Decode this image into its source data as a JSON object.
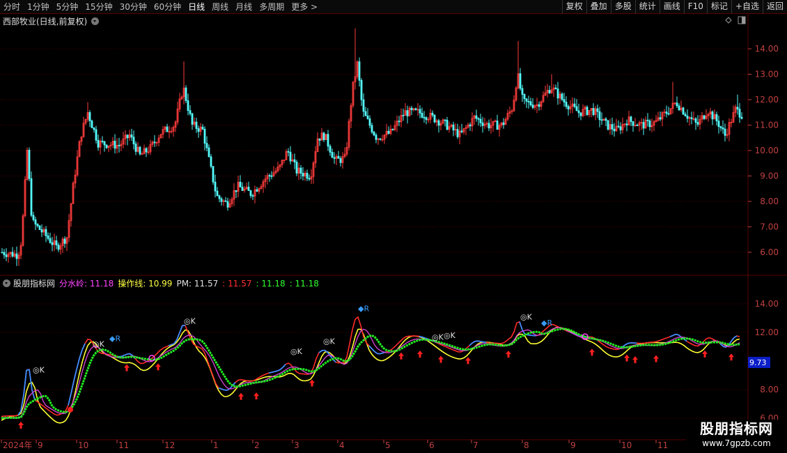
{
  "toolbar": {
    "periods": [
      "分时",
      "1分钟",
      "5分钟",
      "15分钟",
      "30分钟",
      "60分钟",
      "日线",
      "周线",
      "月线",
      "多周期",
      "更多 >"
    ],
    "active_period": "日线",
    "tools": [
      "复权",
      "叠加",
      "多股",
      "统计",
      "画线",
      "F10",
      "标记",
      "+自选",
      "返回"
    ]
  },
  "main_pane": {
    "title": "西部牧业(日线,前复权)",
    "price_axis_labels": [
      "14.00",
      "13.00",
      "12.00",
      "11.00",
      "10.00",
      "9.00",
      "8.00",
      "7.00",
      "6.00"
    ]
  },
  "indicator_pane": {
    "name": "股朋指标网",
    "values": [
      {
        "label": "分水岭: 11.18",
        "color": "#ff44ff"
      },
      {
        "label": "操作线: 10.99",
        "color": "#ffff44"
      },
      {
        "label": "PM: 11.57",
        "color": "#e0e0e0"
      },
      {
        "label": ": 11.57",
        "color": "#ff3030"
      },
      {
        "label": ": 11.18",
        "color": "#30ff30"
      },
      {
        "label": ": 11.18",
        "color": "#30ff30"
      }
    ],
    "axis_labels": [
      "14.00",
      "12.00",
      "8.00",
      "6.00"
    ],
    "current_value_tag": "9.73",
    "markers": {
      "ok": "◎K",
      "r": "◆R"
    }
  },
  "time_axis": {
    "labels": [
      "2024年",
      "9",
      "10",
      "11",
      "12",
      "1",
      "2",
      "3",
      "4",
      "5",
      "6",
      "7",
      "8",
      "9",
      "10",
      "11"
    ]
  },
  "watermark": {
    "name": "股朋指标网",
    "url": "www.7gpzb.com"
  },
  "colors": {
    "up": "#ff3c3c",
    "down": "#54fcfc",
    "grid": "#5a0000",
    "axis_text": "#c04040"
  },
  "chart_data": {
    "type": "candlestick",
    "symbol": "西部牧业",
    "y_range": [
      5.5,
      15.0
    ],
    "x": [
      "2024-08",
      "2024-09",
      "2024-10",
      "2024-11",
      "2024-12",
      "2025-01",
      "2025-02",
      "2025-03",
      "2025-04",
      "2025-05",
      "2025-06",
      "2025-07",
      "2025-08",
      "2025-09",
      "2025-10",
      "2025-11"
    ],
    "close_approx": [
      6.0,
      6.5,
      10.8,
      10.2,
      11.2,
      8.2,
      8.9,
      9.2,
      12.0,
      10.8,
      11.2,
      11.6,
      12.5,
      11.4,
      11.3,
      11.1
    ],
    "highs": {
      "2024-12": 13.5,
      "2025-04": 14.8,
      "2025-07": 14.3,
      "2025-10": 12.7
    },
    "lows": {
      "2024-08": 5.6,
      "2025-01": 7.7,
      "2025-04": 9.2,
      "2025-09": 10.5
    }
  }
}
